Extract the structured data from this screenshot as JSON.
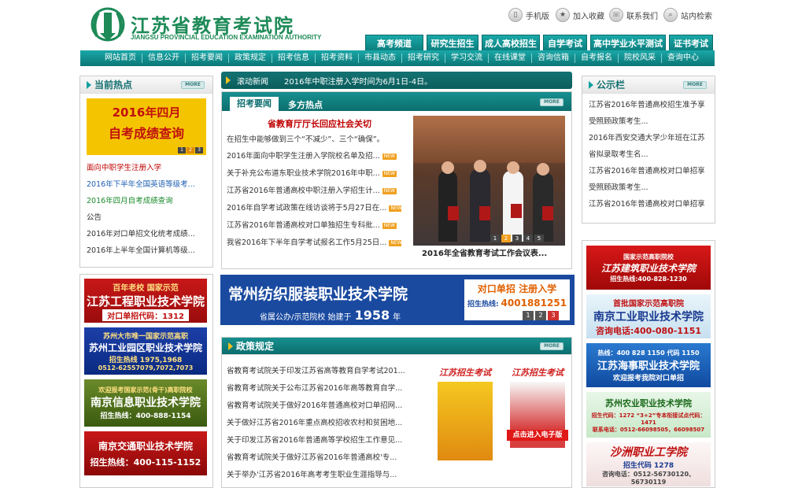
{
  "header": {
    "title_cn": "江苏省教育考试院",
    "title_en": "JIANGSU PROVINCIAL EDUCATION EXAMINATION AUTHORITY",
    "top_links": [
      {
        "label": "手机版",
        "icon": "phone-icon"
      },
      {
        "label": "加入收藏",
        "icon": "favorite-icon"
      },
      {
        "label": "联系我们",
        "icon": "contact-icon"
      },
      {
        "label": "站内检索",
        "icon": "search-icon"
      }
    ],
    "channels": [
      "高考频道",
      "研究生招生",
      "成人高校招生",
      "自学考试",
      "高中学业水平测试",
      "证书考试"
    ]
  },
  "nav": [
    "网站首页",
    "信息公开",
    "招考要闻",
    "政策规定",
    "招考信息",
    "招考资料",
    "市县动态",
    "招考研究",
    "学习交流",
    "在线课堂",
    "咨询信箱",
    "自考报名",
    "院校风采",
    "查询中心"
  ],
  "hot": {
    "title": "当前热点",
    "more": "MORE",
    "banner_line1": "2016年四月",
    "banner_line2": "自考成绩查询",
    "pager": [
      "1",
      "2",
      "3"
    ],
    "items": [
      {
        "text": "面向中职学生注册入学",
        "color": "#c00000"
      },
      {
        "text": "2016年下半年全国英语等级考...",
        "color": "#1f5fb3"
      },
      {
        "text": "2016年四月自考成绩查询",
        "color": "#1a8a2a"
      },
      {
        "text": "公告",
        "color": "#333333"
      },
      {
        "text": "2016年对口单招文化统考成绩...",
        "color": "#333333"
      },
      {
        "text": "2016年上半年全国计算机等级...",
        "color": "#333333"
      }
    ]
  },
  "scroll": {
    "label": "滚动新闻",
    "text": "2016年中职注册入学时间为6月1日-4日。"
  },
  "news": {
    "tabs": [
      "招考要闻",
      "多方热点"
    ],
    "more": "MORE",
    "headline": "省教育厅厅长回应社会关切",
    "summary": "在招生中能够做到三个“不减少”、三个“确保”。",
    "items": [
      "2016年面向中职学生注册入学院校名单及招...",
      "关于补充公布道东职业技术学院2016年中职...",
      "江苏省2016年普通高校中职注册入学招生计...",
      "2016年自学考试政策在线访谈将于5月27日在...",
      "江苏省2016年普通高校对口单独招生专科批...",
      "我省2016年下半年自学考试报名工作5月25日..."
    ],
    "new_label": "NEW",
    "photo_caption": "2016年全省教育考试工作会议表...",
    "photo_pager": [
      "1",
      "2",
      "3",
      "4",
      "5"
    ]
  },
  "notice": {
    "title": "公示栏",
    "more": "MORE",
    "items": [
      "江苏省2016年普通高校招生准予享",
      "受照顾政策考生...",
      "2016年西安交通大学少年班在江苏",
      "省拟录取考生名...",
      "江苏省2016年普通高校对口单招享",
      "受照顾政策考生...",
      "江苏省2016年普通高校对口单招享"
    ]
  },
  "center_ad": {
    "name": "常州纺织服装职业技术学院",
    "sub": "省属公办/示范院校 始建于",
    "year": "1958",
    "year_unit": "年",
    "right1": "对口单招 注册入学",
    "hotline_label": "招生热线:",
    "hotline": "4001881251",
    "pager": [
      "1",
      "2",
      "3"
    ]
  },
  "policy": {
    "title": "政策规定",
    "more": "MORE",
    "items": [
      "省教育考试院关于印发江苏省高等教育自学考试201...",
      "省教育考试院关于公布江苏省2016年高等教育自学...",
      "省教育考试院关于做好2016年普通高校对口单招网...",
      "关于做好江苏省2016年重点高校招收农村和贫困地...",
      "关于印发江苏省2016年普通高等学校招生工作意见...",
      "省教育考试院关于做好江苏省2016年普通高校'专...",
      "关于举办'江苏省2016年高考考生职业生涯指导与..."
    ],
    "mag1": "江苏招生考试",
    "mag2": "江苏招生考试",
    "mag_btn": "点击进入电子版"
  },
  "left_ads": [
    {
      "top": "百年老校 国家示范",
      "name": "江苏工程职业技术学院",
      "foot": "对口单招代码：1312"
    },
    {
      "top": "苏州大市唯一国家示范高职",
      "name": "苏州工业园区职业技术学院",
      "foot": "招生热线 1975,1968",
      "foot2": "0512-62557079,7072,7073"
    },
    {
      "top": "欢迎报考国家示范(骨干)高职院校",
      "name": "南京信息职业技术学院",
      "foot": "招生热线：400-888-1154"
    },
    {
      "top": "",
      "name": "南京交通职业技术学院",
      "foot": "招生热线：400-115-1152"
    }
  ],
  "right_ads": [
    {
      "top": "国家示范高职院校",
      "name": "江苏建筑职业技术学院",
      "foot": "招生热线:400-828-1230"
    },
    {
      "top": "首批国家示范高职院",
      "name": "南京工业职业技术学院",
      "foot": "咨询电话:400-080-1151"
    },
    {
      "top": "热线：400 828 1150  代码 1150",
      "name": "江苏海事职业技术学院",
      "foot": "欢迎报考我院对口单招"
    },
    {
      "top": "",
      "name": "苏州农业职业技术学院",
      "foot": "招生代码：1272 “3+2”专本衔接试点代码：1471",
      "foot2": "联系电话：0512-66098505，66098507"
    },
    {
      "top": "",
      "name": "沙洲职业工学院",
      "foot": "招生代码 1278",
      "foot2": "咨询电话：0512-56730120、56730119"
    }
  ],
  "colors": {
    "teal": "#0e8a8a",
    "green": "#1d8a57",
    "red": "#c00000"
  }
}
